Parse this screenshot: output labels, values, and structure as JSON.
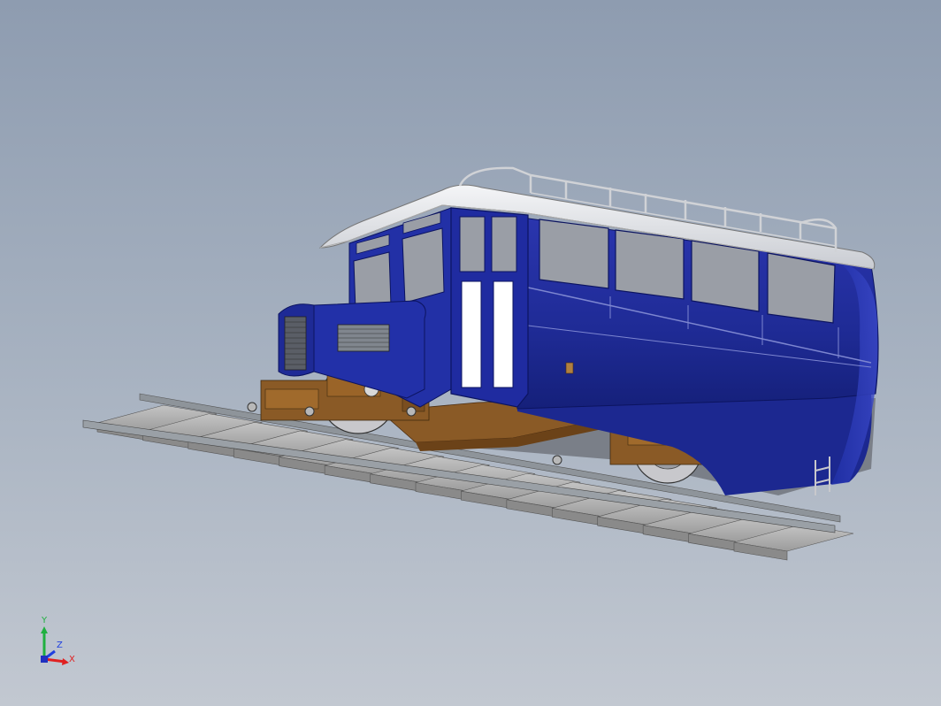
{
  "viewport": {
    "background_top": "#8e9cb0",
    "background_bottom": "#c2c8d1"
  },
  "model": {
    "description_icon": "railcar-3d-model",
    "body_color": "#2431a0",
    "roof_color": "#e8eaee",
    "chassis_color": "#8a5a26",
    "rail_color": "#9aa0a6",
    "sleeper_color": "#a0a0a0",
    "window_color": "#9a9ea6"
  },
  "triad": {
    "x_label": "X",
    "y_label": "Y",
    "z_label": "Z",
    "x_color": "#e02020",
    "y_color": "#20b040",
    "z_color": "#2040e0"
  }
}
